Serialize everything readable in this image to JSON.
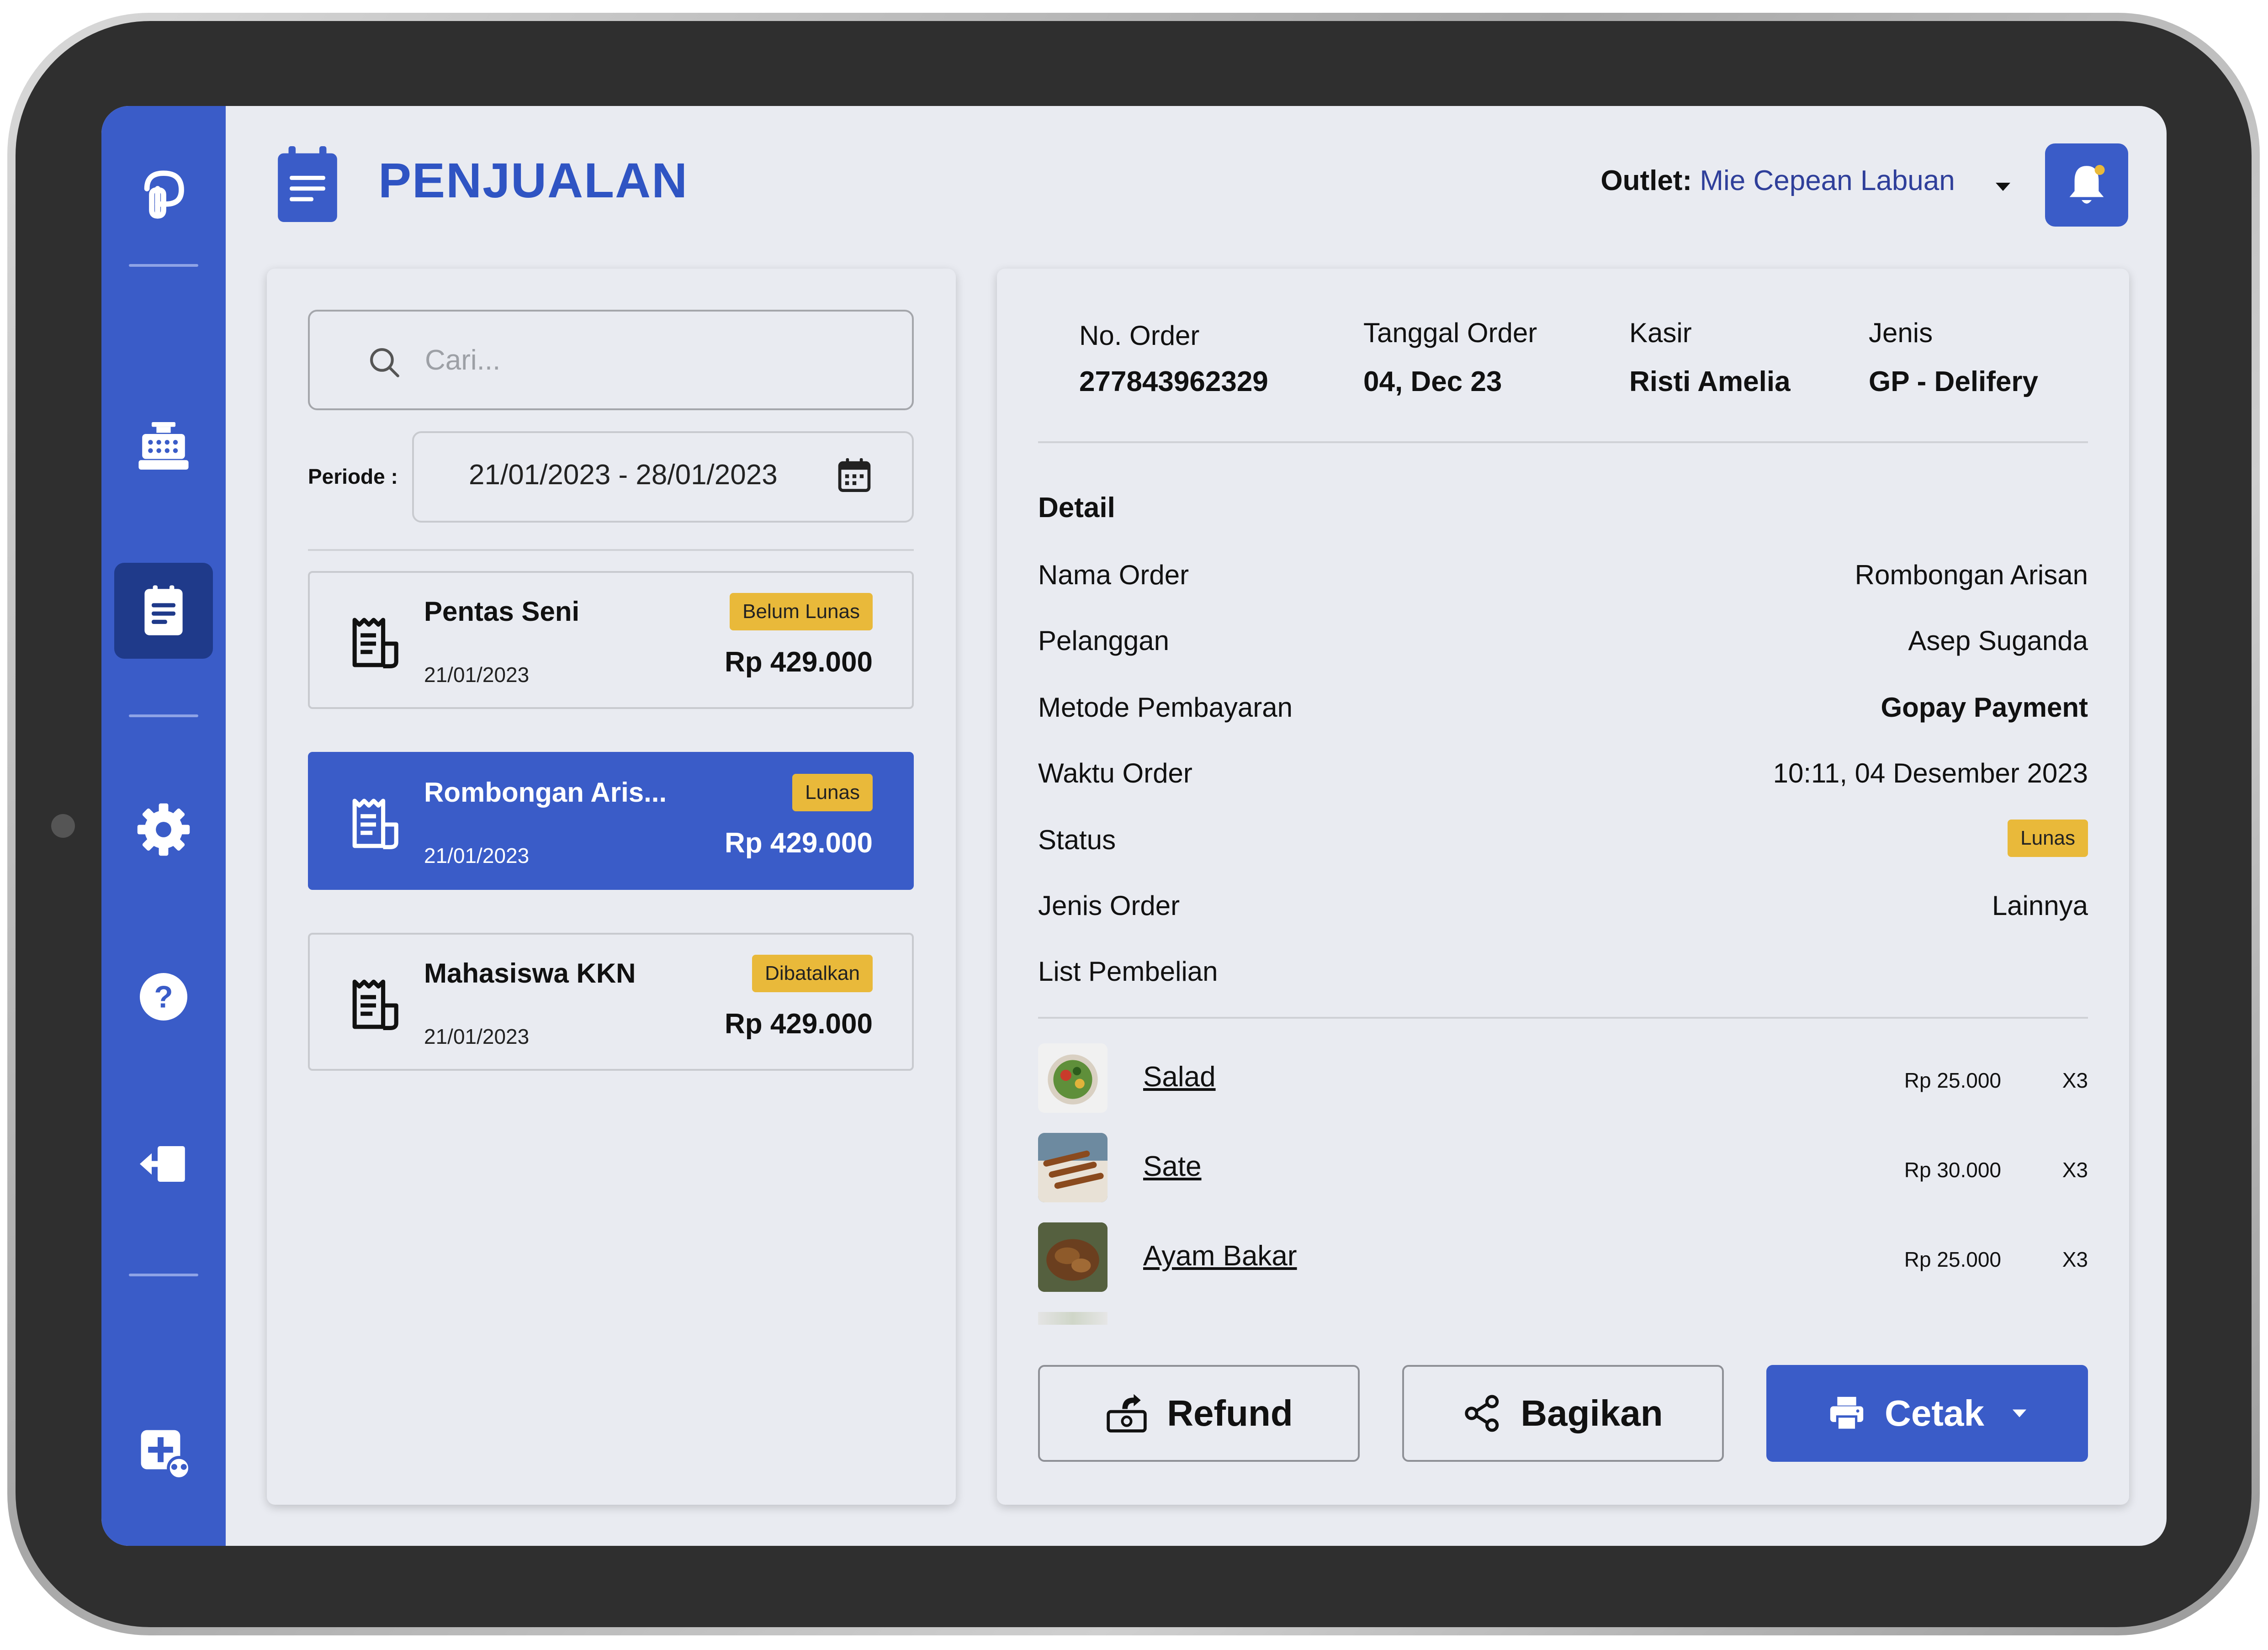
{
  "header": {
    "title": "PENJUALAN",
    "outlet_label": "Outlet:",
    "outlet_value": "Mie Cepean Labuan"
  },
  "sidebar": {
    "items": [
      {
        "icon": "logo-icon"
      },
      {
        "icon": "cash-register-icon"
      },
      {
        "icon": "sales-report-icon",
        "active": true
      },
      {
        "icon": "gear-icon"
      },
      {
        "icon": "help-icon"
      },
      {
        "icon": "logout-icon"
      },
      {
        "icon": "add-outlet-icon"
      }
    ]
  },
  "search": {
    "placeholder": "Cari..."
  },
  "periode": {
    "label": "Periode :",
    "value": "21/01/2023 - 28/01/2023"
  },
  "orders": [
    {
      "name": "Pentas Seni",
      "date": "21/01/2023",
      "price": "Rp 429.000",
      "status": "Belum Lunas"
    },
    {
      "name": "Rombongan Aris...",
      "date": "21/01/2023",
      "price": "Rp 429.000",
      "status": "Lunas"
    },
    {
      "name": "Mahasiswa KKN",
      "date": "21/01/2023",
      "price": "Rp 429.000",
      "status": "Dibatalkan"
    }
  ],
  "detail": {
    "meta": [
      {
        "label": "No. Order",
        "value": "277843962329"
      },
      {
        "label": "Tanggal Order",
        "value": "04, Dec 23"
      },
      {
        "label": "Kasir",
        "value": "Risti Amelia"
      },
      {
        "label": "Jenis",
        "value": "GP - Delifery"
      }
    ],
    "section_title": "Detail",
    "rows": [
      {
        "label": "Nama Order",
        "value": "Rombongan Arisan"
      },
      {
        "label": "Pelanggan",
        "value": "Asep Suganda"
      },
      {
        "label": "Metode Pembayaran",
        "value": "Gopay Payment"
      },
      {
        "label": "Waktu Order",
        "value": "10:11, 04 Desember 2023"
      },
      {
        "label": "Status",
        "value": "Lunas"
      },
      {
        "label": "Jenis Order",
        "value": "Lainnya"
      }
    ],
    "list_title": "List Pembelian",
    "items": [
      {
        "name": "Salad",
        "price": "Rp 25.000",
        "qty": "X3"
      },
      {
        "name": "Sate",
        "price": "Rp 30.000",
        "qty": "X3"
      },
      {
        "name": "Ayam Bakar",
        "price": "Rp 25.000",
        "qty": "X3"
      }
    ]
  },
  "actions": {
    "refund": "Refund",
    "share": "Bagikan",
    "print": "Cetak"
  },
  "colors": {
    "primary": "#3a5cc8",
    "badge": "#e9b93a",
    "background": "#e9ebf1"
  }
}
